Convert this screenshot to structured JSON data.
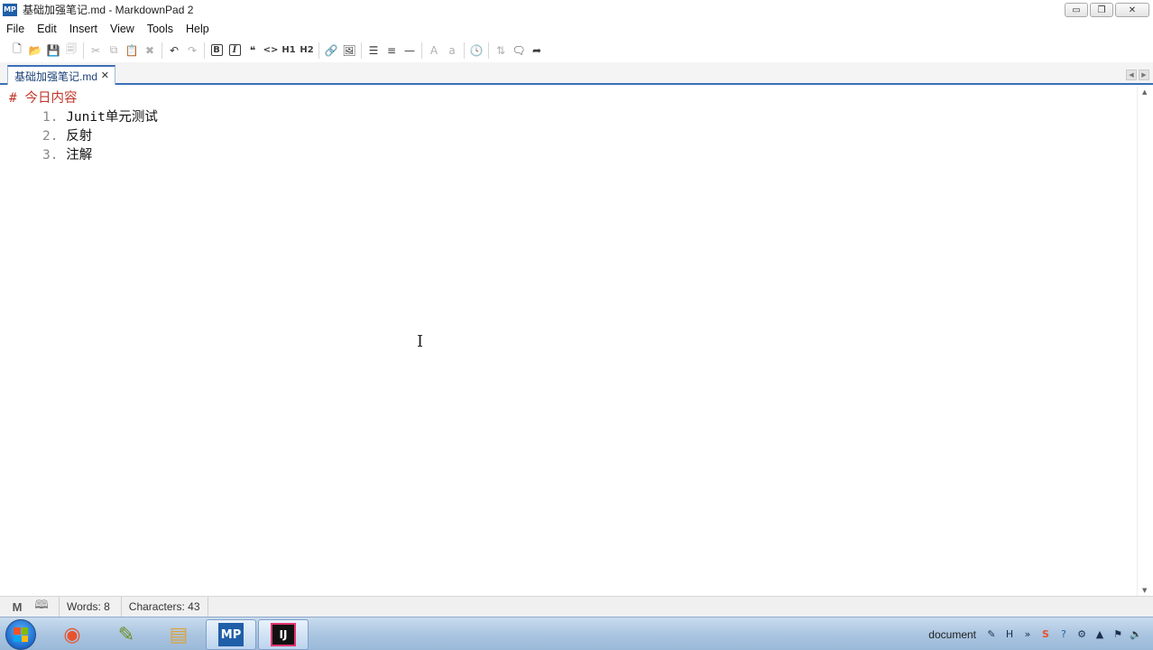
{
  "window": {
    "app_icon_text": "MP",
    "title": "基础加强笔记.md - MarkdownPad 2",
    "controls": {
      "minimize": "▭",
      "maximize": "❐",
      "close": "✕"
    }
  },
  "menu": [
    "File",
    "Edit",
    "Insert",
    "View",
    "Tools",
    "Help"
  ],
  "toolbar": [
    {
      "name": "new-file-icon",
      "glyph": "🗋"
    },
    {
      "name": "open-folder-icon",
      "glyph": "📂"
    },
    {
      "name": "save-icon",
      "glyph": "💾"
    },
    {
      "name": "save-all-icon",
      "glyph": "🗐"
    },
    {
      "name": "cut-icon",
      "glyph": "✂"
    },
    {
      "name": "copy-icon",
      "glyph": "⧉"
    },
    {
      "name": "paste-icon",
      "glyph": "📋"
    },
    {
      "name": "delete-icon",
      "glyph": "✖"
    },
    {
      "name": "undo-icon",
      "glyph": "↶"
    },
    {
      "name": "redo-icon",
      "glyph": "↷"
    },
    {
      "name": "bold-icon",
      "glyph": "B"
    },
    {
      "name": "italic-icon",
      "glyph": "I"
    },
    {
      "name": "quote-icon",
      "glyph": "❝"
    },
    {
      "name": "code-icon",
      "glyph": "<>"
    },
    {
      "name": "heading1-icon",
      "glyph": "H1"
    },
    {
      "name": "heading2-icon",
      "glyph": "H2"
    },
    {
      "name": "link-icon",
      "glyph": "🔗"
    },
    {
      "name": "image-icon",
      "glyph": "🖼"
    },
    {
      "name": "bullet-list-icon",
      "glyph": "☰"
    },
    {
      "name": "numbered-list-icon",
      "glyph": "≡"
    },
    {
      "name": "horizontal-rule-icon",
      "glyph": "—"
    },
    {
      "name": "uppercase-icon",
      "glyph": "A"
    },
    {
      "name": "lowercase-icon",
      "glyph": "a"
    },
    {
      "name": "timestamp-icon",
      "glyph": "🕓"
    },
    {
      "name": "sync-scroll-icon",
      "glyph": "⇅"
    },
    {
      "name": "preview-icon",
      "glyph": "🗨"
    },
    {
      "name": "export-icon",
      "glyph": "➦"
    }
  ],
  "tab": {
    "label": "基础加强笔记.md",
    "close": "✕"
  },
  "editor": {
    "heading": "# 今日内容",
    "list": [
      {
        "num": "1.",
        "text": "Junit单元测试"
      },
      {
        "num": "2.",
        "text": "反射"
      },
      {
        "num": "3.",
        "text": "注解"
      }
    ]
  },
  "status": {
    "markdown_icon": "M",
    "book_icon": "🕮",
    "words": "Words: 8",
    "characters": "Characters: 43"
  },
  "taskbar": {
    "apps": [
      {
        "name": "taskbar-app-browser",
        "glyph": "◉",
        "active": false
      },
      {
        "name": "taskbar-app-paint",
        "glyph": "✎",
        "active": false
      },
      {
        "name": "taskbar-app-explorer",
        "glyph": "▤",
        "active": false
      },
      {
        "name": "taskbar-app-markdownpad",
        "glyph": "MP",
        "active": true
      },
      {
        "name": "taskbar-app-intellij",
        "glyph": "IJ",
        "active": true
      }
    ],
    "tray_label": "document"
  }
}
